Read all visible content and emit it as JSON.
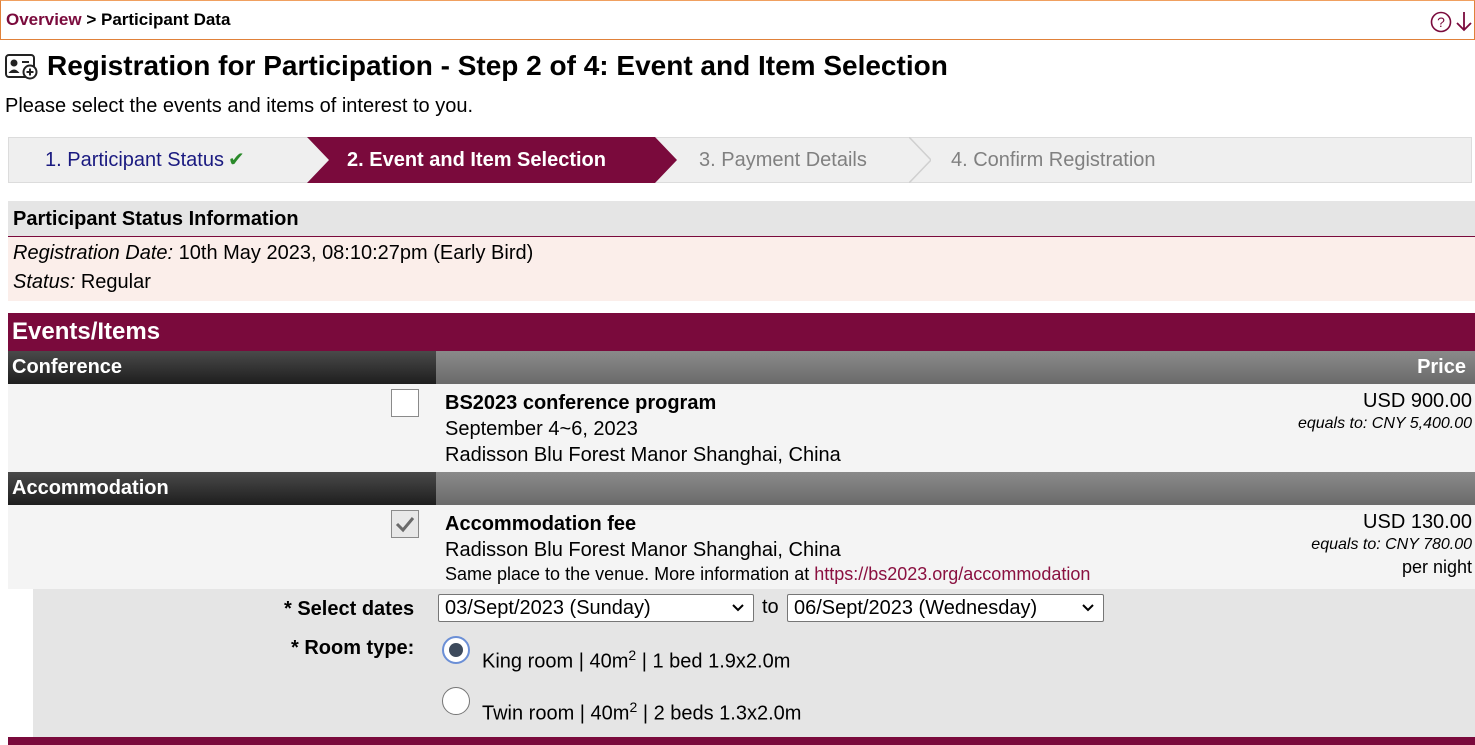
{
  "breadcrumb": {
    "overview": "Overview",
    "separator": " > ",
    "current": "Participant Data"
  },
  "page": {
    "title": "Registration for Participation - Step 2 of 4: Event and Item Selection",
    "subtitle": "Please select the events and items of interest to you."
  },
  "steps": [
    {
      "label": "1. Participant Status",
      "state": "done"
    },
    {
      "label": "2. Event and Item Selection",
      "state": "current"
    },
    {
      "label": "3. Payment Details",
      "state": "pending"
    },
    {
      "label": "4. Confirm Registration",
      "state": "pending"
    }
  ],
  "participant_status": {
    "heading": "Participant Status Information",
    "reg_date_label": "Registration Date:",
    "reg_date_value": " 10th May 2023, 08:10:27pm (Early Bird)",
    "status_label": "Status:",
    "status_value": " Regular"
  },
  "events": {
    "heading": "Events/Items",
    "price_header": "Price",
    "conference": {
      "category": "Conference",
      "checked": false,
      "title": "BS2023 conference program",
      "dates": "September 4~6, 2023",
      "venue": "Radisson Blu Forest Manor Shanghai, China",
      "price": "USD 900.00",
      "equals": "equals to: CNY 5,400.00"
    },
    "accommodation": {
      "category": "Accommodation",
      "checked": true,
      "title": "Accommodation fee",
      "venue": "Radisson Blu Forest Manor Shanghai, China",
      "note": "Same place to the venue. More information at ",
      "link": "https://bs2023.org/accommodation",
      "price": "USD 130.00",
      "equals": "equals to: CNY 780.00",
      "unit": "per night",
      "select_dates_label": "* Select dates",
      "date_from": "03/Sept/2023 (Sunday)",
      "date_to_word": "to",
      "date_to": "06/Sept/2023 (Wednesday)",
      "room_type_label": "* Room type:",
      "rooms": [
        {
          "pre": "King room | 40m",
          "sup": "2",
          "post": " | 1 bed 1.9x2.0m",
          "selected": true
        },
        {
          "pre": "Twin room | 40m",
          "sup": "2",
          "post": " | 2 beds 1.3x2.0m",
          "selected": false
        }
      ]
    }
  },
  "colors": {
    "brand": "#7a0a3c",
    "step_done": "#1a1a80",
    "check": "#2a8a2a"
  }
}
